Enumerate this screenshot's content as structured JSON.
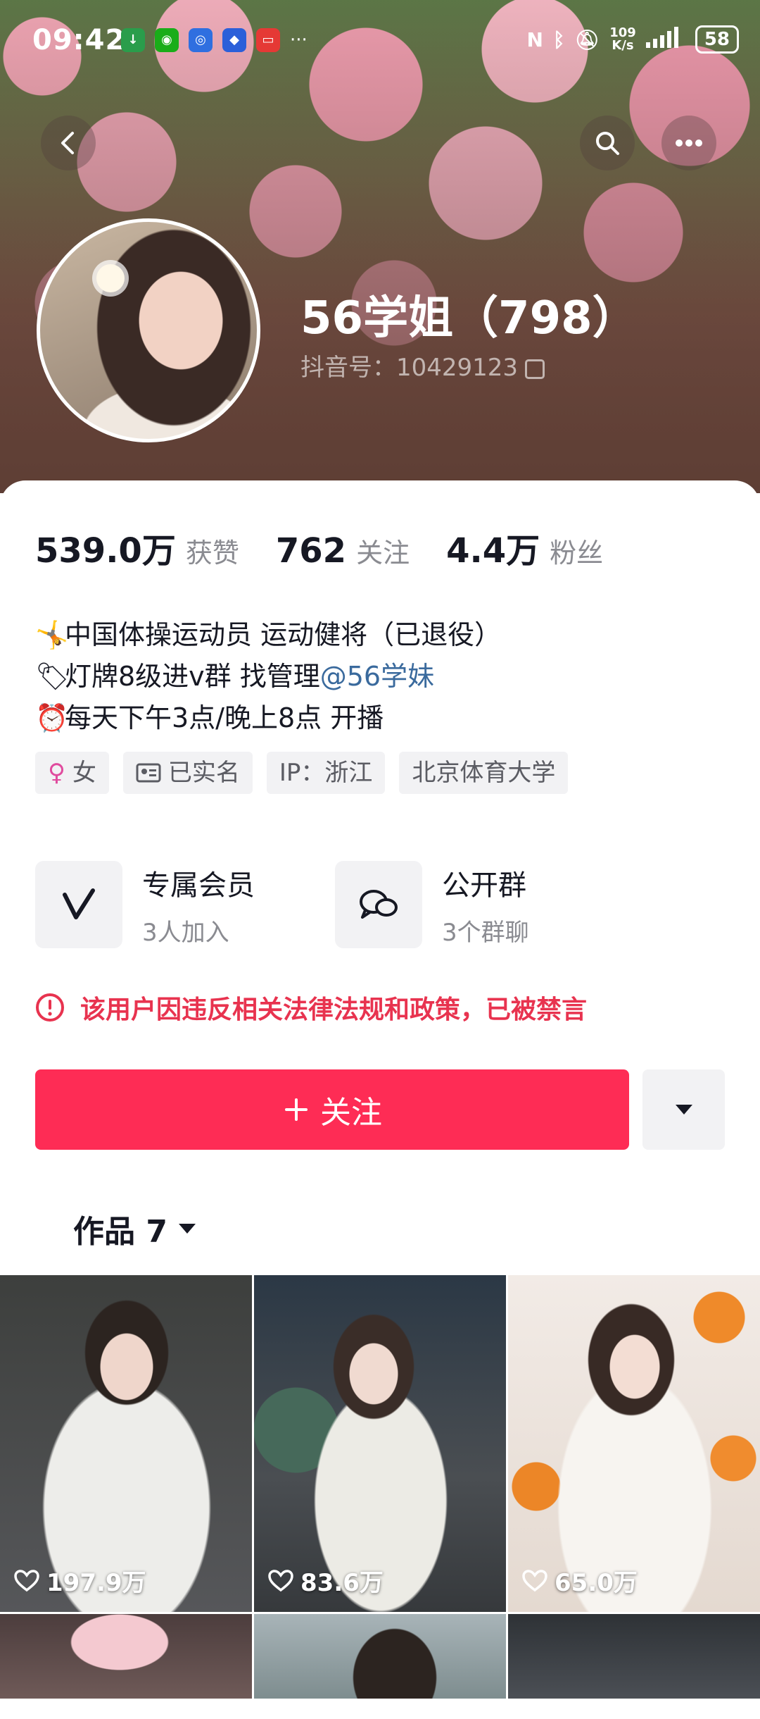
{
  "status_bar": {
    "time": "09:42",
    "more": "···",
    "net_speed_value": "109",
    "net_speed_unit": "K/s",
    "battery": "58"
  },
  "profile": {
    "name": "56学姐（798）",
    "douyin_id": "抖音号：10429123"
  },
  "stats": [
    {
      "value": "539.0万",
      "label": "获赞"
    },
    {
      "value": "762",
      "label": "关注"
    },
    {
      "value": "4.4万",
      "label": "粉丝"
    }
  ],
  "bio": {
    "line1": "中国体操运动员 运动健将（已退役）",
    "line2_prefix": "灯牌8级进v群 找管理",
    "line2_mention": "@56学妹",
    "line3": "每天下午3点/晚上8点 开播"
  },
  "tags": {
    "gender": "女",
    "verified": "已实名",
    "ip": "IP：浙江",
    "school": "北京体育大学"
  },
  "services": [
    {
      "title": "专属会员",
      "subtitle": "3人加入",
      "icon": "v-logo-icon"
    },
    {
      "title": "公开群",
      "subtitle": "3个群聊",
      "icon": "chat-bubbles-icon"
    }
  ],
  "ban_notice": "该用户因违反相关法律法规和政策，已被禁言",
  "follow_button": "关注",
  "works_tab": "作品 7",
  "videos": [
    {
      "likes": "197.9万"
    },
    {
      "likes": "83.6万"
    },
    {
      "likes": "65.0万"
    }
  ],
  "colors": {
    "accent": "#fe2c55",
    "warning": "#e8334f",
    "mention": "#3a6a9d"
  }
}
